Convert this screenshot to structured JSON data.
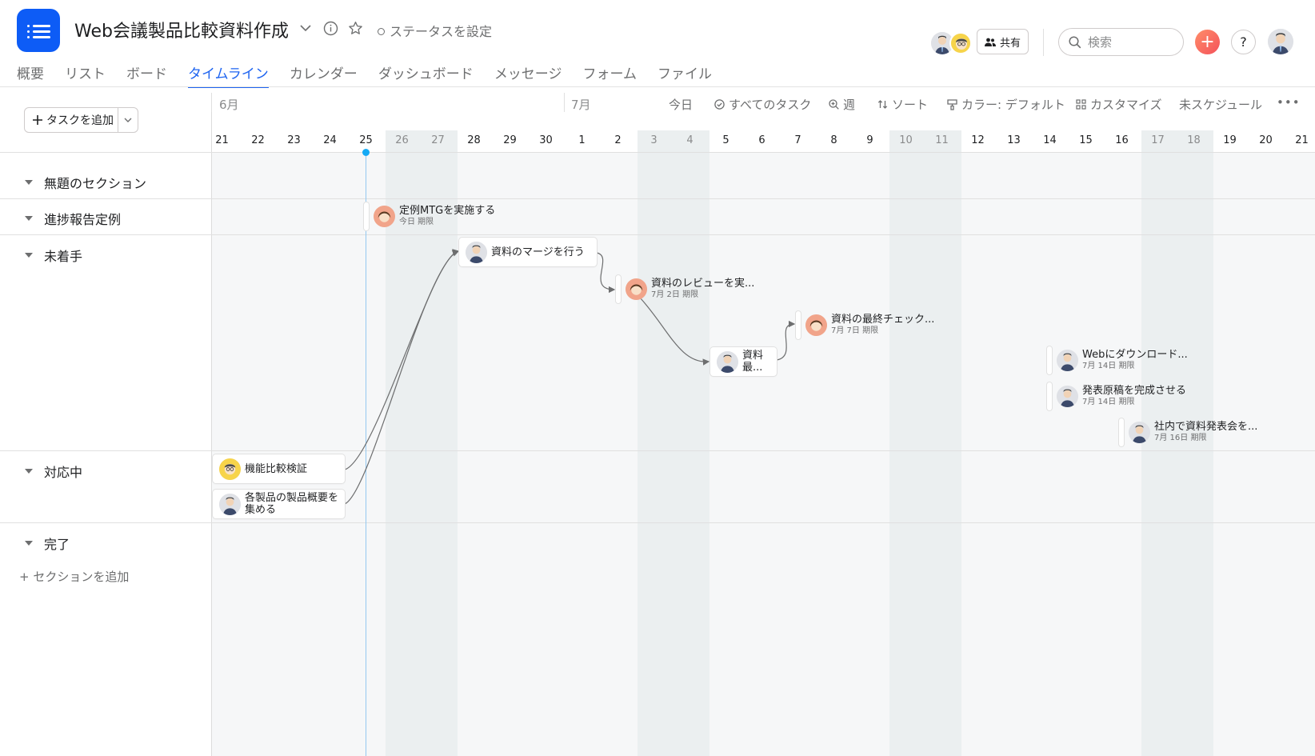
{
  "project": {
    "title": "Web会議製品比較資料作成",
    "status_label": "ステータスを設定"
  },
  "header": {
    "share_label": "共有",
    "search_placeholder": "検索",
    "plus_label": "+",
    "help_label": "?"
  },
  "tabs": [
    {
      "label": "概要"
    },
    {
      "label": "リスト"
    },
    {
      "label": "ボード"
    },
    {
      "label": "タイムライン",
      "active": true
    },
    {
      "label": "カレンダー"
    },
    {
      "label": "ダッシュボード"
    },
    {
      "label": "メッセージ"
    },
    {
      "label": "フォーム"
    },
    {
      "label": "ファイル"
    }
  ],
  "toolbar": {
    "add_task_label": "タスクを追加",
    "today": "今日",
    "all_tasks": "すべてのタスク",
    "week": "週",
    "sort": "ソート",
    "color": "カラー: デフォルト",
    "customize": "カスタマイズ",
    "unscheduled": "未スケジュール",
    "more": "•••"
  },
  "timeline": {
    "months": [
      "6月",
      "7月"
    ],
    "days": [
      "21",
      "22",
      "23",
      "24",
      "25",
      "26",
      "27",
      "28",
      "29",
      "30",
      "1",
      "2",
      "3",
      "4",
      "5",
      "6",
      "7",
      "8",
      "9",
      "10",
      "11",
      "12",
      "13",
      "14",
      "15",
      "16",
      "17",
      "18",
      "19",
      "20",
      "21"
    ],
    "weekend_days": [
      5,
      6,
      12,
      13,
      19,
      20,
      26,
      27
    ],
    "today_day": "25"
  },
  "sections": [
    {
      "label": "無題のセクション"
    },
    {
      "label": "進捗報告定例"
    },
    {
      "label": "未着手"
    },
    {
      "label": "対応中"
    },
    {
      "label": "完了"
    }
  ],
  "add_section_label": "+ セクションを追加",
  "tasks": {
    "teirei": {
      "name": "定例MTGを実施する",
      "due": "今日 期限"
    },
    "merge": {
      "name": "資料のマージを行う"
    },
    "review": {
      "name": "資料のレビューを実...",
      "due": "7月 2日 期限"
    },
    "saishu_small": {
      "line1": "資料",
      "line2": "最..."
    },
    "final_check": {
      "name": "資料の最終チェック...",
      "due": "7月 7日 期限"
    },
    "download": {
      "name": "Webにダウンロード...",
      "due": "7月 14日 期限"
    },
    "manuscript": {
      "name": "発表原稿を完成させる",
      "due": "7月 14日 期限"
    },
    "presentation": {
      "name": "社内で資料発表会を...",
      "due": "7月 16日 期限"
    },
    "kinou": {
      "name": "機能比較検証"
    },
    "gaiyou": {
      "line1": "各製品の製品概要を",
      "line2": "集める"
    }
  },
  "colors": {
    "accent": "#1e64f0",
    "app_icon": "#0d5cf6",
    "today": "#14aaf5"
  }
}
